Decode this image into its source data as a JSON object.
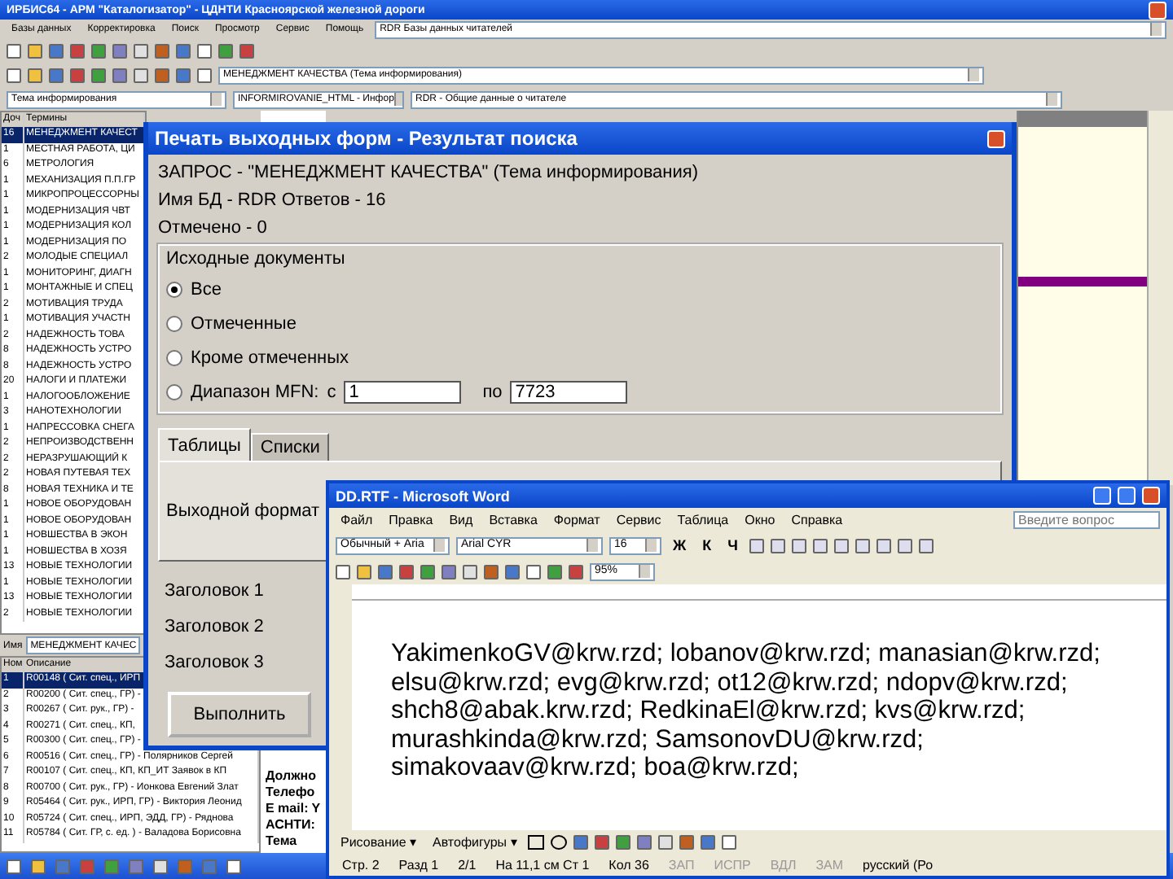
{
  "main_window": {
    "title": "ИРБИС64 - АРМ \"Каталогизатор\" - ЦДНТИ Красноярской железной дороги",
    "menu": [
      "Базы данных",
      "Корректировка",
      "Поиск",
      "Просмотр",
      "Сервис",
      "Помощь"
    ],
    "database_field": "RDR  Базы данных читателей",
    "query_field": "МЕНЕДЖМЕНТ КАЧЕСТВА (Тема информирования)",
    "dropdowns": [
      "Тема информирования",
      "INFORMIROVANIE_HTML - Инфор",
      "RDR - Общие данные о читателе"
    ],
    "terms_header": [
      "Доч",
      "Термины"
    ],
    "terms": [
      {
        "count": "16",
        "term": "МЕНЕДЖМЕНТ КАЧЕСТ",
        "selected": true
      },
      {
        "count": "1",
        "term": "МЕСТНАЯ РАБОТА, ЦИ",
        "selected": false
      },
      {
        "count": "6",
        "term": "МЕТРОЛОГИЯ",
        "selected": false
      },
      {
        "count": "1",
        "term": "МЕХАНИЗАЦИЯ П.П.ГР",
        "selected": false
      },
      {
        "count": "1",
        "term": "МИКРОПРОЦЕССОРНЫ",
        "selected": false
      },
      {
        "count": "1",
        "term": "МОДЕРНИЗАЦИЯ ЧВТ",
        "selected": false
      },
      {
        "count": "1",
        "term": "МОДЕРНИЗАЦИЯ КОЛ",
        "selected": false
      },
      {
        "count": "1",
        "term": "МОДЕРНИЗАЦИЯ ПО",
        "selected": false
      },
      {
        "count": "2",
        "term": "МОЛОДЫЕ СПЕЦИАЛ",
        "selected": false
      },
      {
        "count": "1",
        "term": "МОНИТОРИНГ, ДИАГН",
        "selected": false
      },
      {
        "count": "1",
        "term": "МОНТАЖНЫЕ И СПЕЦ",
        "selected": false
      },
      {
        "count": "2",
        "term": "МОТИВАЦИЯ ТРУДА",
        "selected": false
      },
      {
        "count": "1",
        "term": "МОТИВАЦИЯ УЧАСТН",
        "selected": false
      },
      {
        "count": "2",
        "term": "НАДЕЖНОСТЬ ТОВА",
        "selected": false
      },
      {
        "count": "8",
        "term": "НАДЕЖНОСТЬ УСТРО",
        "selected": false
      },
      {
        "count": "8",
        "term": "НАДЕЖНОСТЬ УСТРО",
        "selected": false
      },
      {
        "count": "20",
        "term": "НАЛОГИ И ПЛАТЕЖИ",
        "selected": false
      },
      {
        "count": "1",
        "term": "НАЛОГООБЛОЖЕНИЕ",
        "selected": false
      },
      {
        "count": "3",
        "term": "НАНОТЕХНОЛОГИИ",
        "selected": false
      },
      {
        "count": "1",
        "term": "НАПРЕССОВКА СНЕГА",
        "selected": false
      },
      {
        "count": "2",
        "term": "НЕПРОИЗВОДСТВЕНН",
        "selected": false
      },
      {
        "count": "2",
        "term": "НЕРАЗРУШАЮЩИЙ К",
        "selected": false
      },
      {
        "count": "2",
        "term": "НОВАЯ ПУТЕВАЯ ТЕХ",
        "selected": false
      },
      {
        "count": "8",
        "term": "НОВАЯ ТЕХНИКА И ТЕ",
        "selected": false
      },
      {
        "count": "1",
        "term": "НОВОЕ ОБОРУДОВАН",
        "selected": false
      },
      {
        "count": "1",
        "term": "НОВОЕ ОБОРУДОВАН",
        "selected": false
      },
      {
        "count": "1",
        "term": "НОВШЕСТВА В ЭКОН",
        "selected": false
      },
      {
        "count": "1",
        "term": "НОВШЕСТВА В ХОЗЯ",
        "selected": false
      },
      {
        "count": "13",
        "term": "НОВЫЕ ТЕХНОЛОГИИ",
        "selected": false
      },
      {
        "count": "1",
        "term": "НОВЫЕ ТЕХНОЛОГИИ",
        "selected": false
      },
      {
        "count": "13",
        "term": "НОВЫЕ ТЕХНОЛОГИИ",
        "selected": false
      },
      {
        "count": "2",
        "term": "НОВЫЕ ТЕХНОЛОГИИ",
        "selected": false
      }
    ],
    "name_label": "Имя",
    "name_field": "МЕНЕДЖМЕНТ КАЧЕС",
    "results_header": [
      "Ном",
      "Описание"
    ],
    "results": [
      {
        "number": "1",
        "text": "R00148 ( Сит. спец., ИРП",
        "selected": true
      },
      {
        "number": "2",
        "text": "R00200 ( Сит. спец., ГР) -",
        "selected": false
      },
      {
        "number": "3",
        "text": "R00267 ( Сит. рук., ГР) -",
        "selected": false
      },
      {
        "number": "4",
        "text": "R00271 ( Сит. спец., КП,",
        "selected": false
      },
      {
        "number": "5",
        "text": "R00300 ( Сит. спец., ГР) -",
        "selected": false
      },
      {
        "number": "6",
        "text": "R00516 ( Сит. спец., ГР) - Полярников Сергей",
        "selected": false
      },
      {
        "number": "7",
        "text": "R00107 ( Сит. спец., КП, КП_ИТ Заявок в КП",
        "selected": false
      },
      {
        "number": "8",
        "text": "R00700 ( Сит. рук., ГР) - Ионкова Евгений Злат",
        "selected": false
      },
      {
        "number": "9",
        "text": "R05464 ( Сит. рук., ИРП, ГР) - Виктория Леонид",
        "selected": false
      },
      {
        "number": "10",
        "text": "R05724 ( Сит. спец., ИРП, ЭДД, ГР) - Ряднова",
        "selected": false
      },
      {
        "number": "11",
        "text": "R05784 ( Сит. ГР, с. ед. ) - Валадова Борисовна",
        "selected": false
      }
    ],
    "record_lines": [
      "Должно",
      "Телефо",
      "E mail: Y",
      "АСНТИ:",
      "Тема"
    ]
  },
  "search_dialog": {
    "title": "Печать выходных форм - Результат поиска",
    "info": [
      "ЗАПРОС - \"МЕНЕДЖМЕНТ КАЧЕСТВА\" (Тема информирования)",
      "Имя БД - RDR  Ответов - 16",
      "Отмечено - 0"
    ],
    "group_title": "Исходные документы",
    "options": [
      {
        "label": "Все",
        "selected": true
      },
      {
        "label": "Отмеченные",
        "selected": false
      },
      {
        "label": "Кроме отмеченных",
        "selected": false
      },
      {
        "label": "Диапазон MFN:",
        "selected": false
      }
    ],
    "range_from_label": "с",
    "range_from": "1",
    "range_to_label": "по",
    "range_to": "7723",
    "tabs": [
      {
        "label": "Таблицы",
        "selected": true
      },
      {
        "label": "Списки",
        "selected": false
      }
    ],
    "format_label": "Выходной формат",
    "headings": [
      "Заголовок 1",
      "Заголовок 2",
      "Заголовок 3"
    ],
    "run_button": "Выполнить"
  },
  "word_window": {
    "title": "DD.RTF - Microsoft Word",
    "menu": [
      "Файл",
      "Правка",
      "Вид",
      "Вставка",
      "Формат",
      "Сервис",
      "Таблица",
      "Окно",
      "Справка"
    ],
    "help_placeholder": "Введите вопрос",
    "style": "Обычный + Aria",
    "font": "Arial CYR",
    "size": "16",
    "format_buttons": [
      "Ж",
      "К",
      "Ч"
    ],
    "zoom": "95%",
    "document_text": "YakimenkoGV@krw.rzd; lobanov@krw.rzd; manasian@krw.rzd; elsu@krw.rzd; evg@krw.rzd; ot12@krw.rzd; ndopv@krw.rzd; shch8@abak.krw.rzd; RedkinaEl@krw.rzd; kvs@krw.rzd; murashkinda@krw.rzd; SamsonovDU@krw.rzd; simakovaav@krw.rzd; boa@krw.rzd;",
    "drawing_menus": [
      "Рисование ▾",
      "Автофигуры ▾"
    ],
    "status": [
      {
        "text": "Стр. 2",
        "enabled": true
      },
      {
        "text": "Разд 1",
        "enabled": true
      },
      {
        "text": "2/1",
        "enabled": true
      },
      {
        "text": "На 11,1 см Ст 1",
        "enabled": true
      },
      {
        "text": "Кол 36",
        "enabled": true
      },
      {
        "text": "ЗАП",
        "enabled": false
      },
      {
        "text": "ИСПР",
        "enabled": false
      },
      {
        "text": "ВДЛ",
        "enabled": false
      },
      {
        "text": "ЗАМ",
        "enabled": false
      },
      {
        "text": "русский (Ро",
        "enabled": true
      }
    ]
  }
}
